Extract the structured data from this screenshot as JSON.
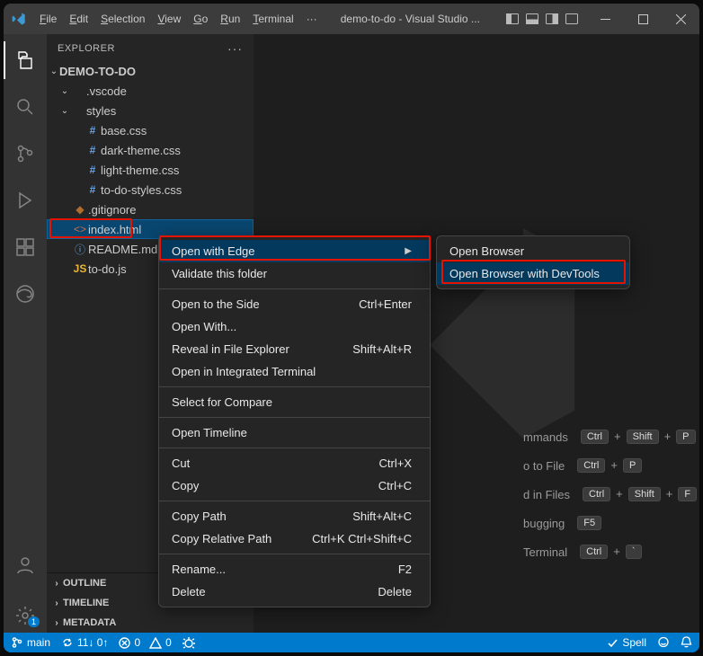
{
  "menubar": {
    "file": "File",
    "edit": "Edit",
    "selection": "Selection",
    "view": "View",
    "go": "Go",
    "run": "Run",
    "terminal": "Terminal",
    "more": "···"
  },
  "title": "demo-to-do - Visual Studio ...",
  "explorer": {
    "title": "EXPLORER",
    "more": "···"
  },
  "tree": {
    "root": "DEMO-TO-DO",
    "vscode": ".vscode",
    "styles": "styles",
    "base": "base.css",
    "dark": "dark-theme.css",
    "light": "light-theme.css",
    "todostyles": "to-do-styles.css",
    "gitignore": ".gitignore",
    "index": "index.html",
    "readme": "README.md",
    "todojs": "to-do.js"
  },
  "collapsed": {
    "outline": "OUTLINE",
    "timeline": "TIMELINE",
    "metadata": "METADATA"
  },
  "ctx": {
    "openEdge": "Open with Edge",
    "validate": "Validate this folder",
    "openSide": "Open to the Side",
    "openSideKey": "Ctrl+Enter",
    "openWith": "Open With...",
    "reveal": "Reveal in File Explorer",
    "revealKey": "Shift+Alt+R",
    "openTerm": "Open in Integrated Terminal",
    "selectCompare": "Select for Compare",
    "openTimeline": "Open Timeline",
    "cut": "Cut",
    "cutKey": "Ctrl+X",
    "copy": "Copy",
    "copyKey": "Ctrl+C",
    "copyPath": "Copy Path",
    "copyPathKey": "Shift+Alt+C",
    "copyRel": "Copy Relative Path",
    "copyRelKey": "Ctrl+K Ctrl+Shift+C",
    "rename": "Rename...",
    "renameKey": "F2",
    "delete": "Delete",
    "deleteKey": "Delete"
  },
  "sub": {
    "openBrowser": "Open Browser",
    "openDevtools": "Open Browser with DevTools"
  },
  "welcome": {
    "l1": "mmands",
    "l2": "o to File",
    "l3": "d in Files",
    "l4": "bugging",
    "l5": "Terminal",
    "k1a": "Ctrl",
    "k1b": "Shift",
    "k1c": "P",
    "k2a": "Ctrl",
    "k2b": "P",
    "k3a": "Ctrl",
    "k3b": "Shift",
    "k3c": "F",
    "k4": "F5",
    "k5a": "Ctrl",
    "k5b": "`"
  },
  "status": {
    "branch": "main",
    "sync": "11↓ 0↑",
    "errors": "0",
    "warnings": "0",
    "spell": "Spell",
    "badge": "1"
  }
}
